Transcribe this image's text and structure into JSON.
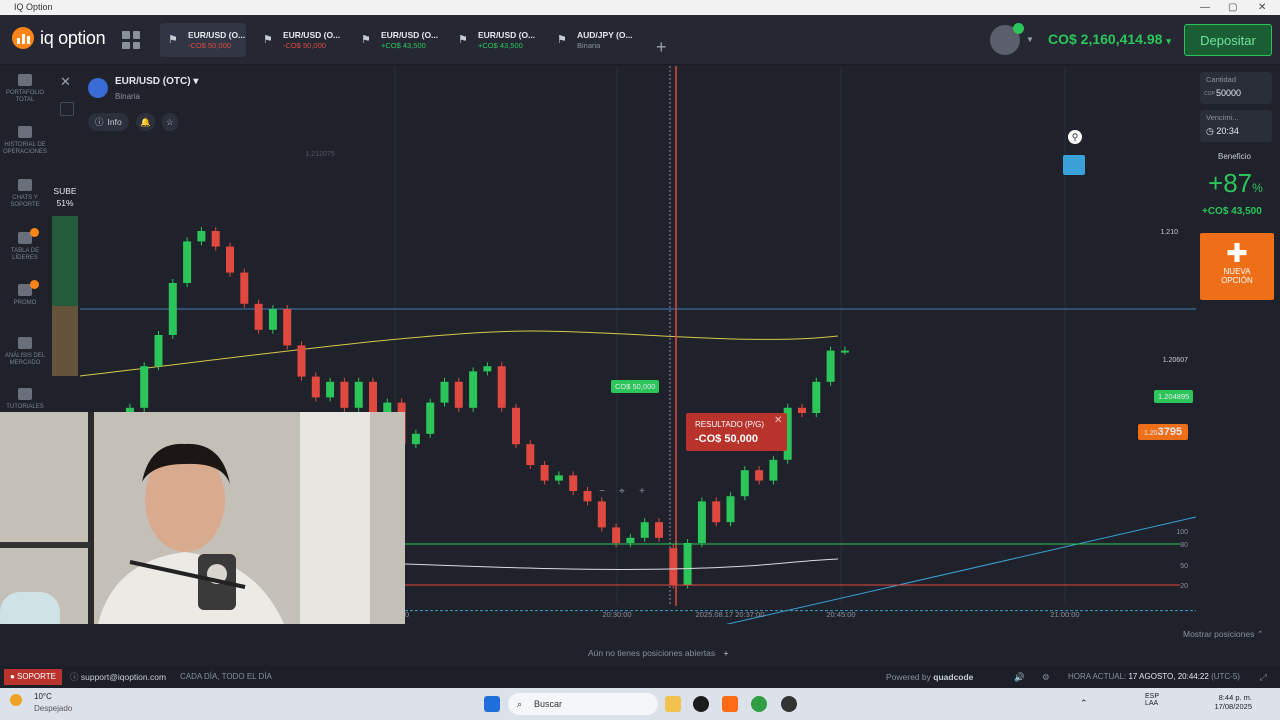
{
  "window": {
    "title": "IQ Option"
  },
  "logo": {
    "text": "iq option"
  },
  "tabs": [
    {
      "title": "EUR/USD (O...",
      "sub": "-CO$ 50,000",
      "tone": "neg",
      "active": true
    },
    {
      "title": "EUR/USD (O...",
      "sub": "-CO$ 50,000",
      "tone": "neg"
    },
    {
      "title": "EUR/USD (O...",
      "sub": "+CO$ 43,500",
      "tone": "pos"
    },
    {
      "title": "EUR/USD (O...",
      "sub": "+CO$ 43,500",
      "tone": "pos"
    },
    {
      "title": "AUD/JPY (O...",
      "sub": "Binaria",
      "tone": "mut"
    }
  ],
  "header": {
    "balance": "CO$ 2,160,414.98",
    "deposit_label": "Depositar"
  },
  "sidebar": {
    "items": [
      {
        "label": "PORTAFOLIO TOTAL"
      },
      {
        "label": "HISTORIAL DE OPERACIONES"
      },
      {
        "label": "CHATS Y SOPORTE"
      },
      {
        "label": "TABLA DE LÍDERES",
        "badge": "2"
      },
      {
        "label": "PROMO",
        "badge": "4"
      },
      {
        "label": "ANÁLISIS DEL MERCADO"
      },
      {
        "label": "TUTORIALES"
      }
    ]
  },
  "asset": {
    "name": "EUR/USD (OTC)",
    "type": "Binaria",
    "info_label": "Info"
  },
  "sentiment": {
    "label": "SUBE",
    "value": "51%"
  },
  "chart": {
    "price_labels": {
      "top": "1.212075",
      "level": "1.210",
      "strike": "1.20607",
      "current": "1.204895",
      "deal": "1.20",
      "deal_big": "3795"
    },
    "x_ticks": [
      "0",
      "20:30:00",
      "2025.08.17 20:37:00",
      "20:45:00",
      "21:00:00"
    ],
    "osc_ticks": [
      "100",
      "80",
      "50",
      "20"
    ],
    "trade_tag": "CO$ 50,000",
    "result": {
      "label": "RESULTADO (P/G)",
      "value": "-CO$ 50,000"
    },
    "candles": [
      {
        "o": 1.2075,
        "c": 1.208
      },
      {
        "o": 1.2077,
        "c": 1.2078
      },
      {
        "o": 1.2078,
        "c": 1.2081
      },
      {
        "o": 1.2078,
        "c": 1.2086
      },
      {
        "o": 1.2086,
        "c": 1.2094
      },
      {
        "o": 1.2094,
        "c": 1.21
      },
      {
        "o": 1.21,
        "c": 1.211
      },
      {
        "o": 1.211,
        "c": 1.2118
      },
      {
        "o": 1.2118,
        "c": 1.212
      },
      {
        "o": 1.212,
        "c": 1.2117
      },
      {
        "o": 1.2117,
        "c": 1.2112
      },
      {
        "o": 1.2112,
        "c": 1.2106
      },
      {
        "o": 1.2106,
        "c": 1.2101
      },
      {
        "o": 1.2101,
        "c": 1.2105
      },
      {
        "o": 1.2105,
        "c": 1.2098
      },
      {
        "o": 1.2098,
        "c": 1.2092
      },
      {
        "o": 1.2092,
        "c": 1.2088
      },
      {
        "o": 1.2088,
        "c": 1.2091
      },
      {
        "o": 1.2091,
        "c": 1.2086
      },
      {
        "o": 1.2086,
        "c": 1.2091
      },
      {
        "o": 1.2091,
        "c": 1.2085
      },
      {
        "o": 1.2085,
        "c": 1.2087
      },
      {
        "o": 1.2087,
        "c": 1.2079
      },
      {
        "o": 1.2079,
        "c": 1.2081
      },
      {
        "o": 1.2081,
        "c": 1.2087
      },
      {
        "o": 1.2087,
        "c": 1.2091
      },
      {
        "o": 1.2091,
        "c": 1.2086
      },
      {
        "o": 1.2086,
        "c": 1.2093
      },
      {
        "o": 1.2093,
        "c": 1.2094
      },
      {
        "o": 1.2094,
        "c": 1.2086
      },
      {
        "o": 1.2086,
        "c": 1.2079
      },
      {
        "o": 1.2079,
        "c": 1.2075
      },
      {
        "o": 1.2075,
        "c": 1.2072
      },
      {
        "o": 1.2072,
        "c": 1.2073
      },
      {
        "o": 1.2073,
        "c": 1.207
      },
      {
        "o": 1.207,
        "c": 1.2068
      },
      {
        "o": 1.2068,
        "c": 1.2063
      },
      {
        "o": 1.2063,
        "c": 1.206
      },
      {
        "o": 1.206,
        "c": 1.2061
      },
      {
        "o": 1.2061,
        "c": 1.2064
      },
      {
        "o": 1.2064,
        "c": 1.2061
      },
      {
        "o": 1.2059,
        "c": 1.2052
      },
      {
        "o": 1.2052,
        "c": 1.206
      },
      {
        "o": 1.206,
        "c": 1.2068
      },
      {
        "o": 1.2068,
        "c": 1.2064
      },
      {
        "o": 1.2064,
        "c": 1.2069
      },
      {
        "o": 1.2069,
        "c": 1.2074
      },
      {
        "o": 1.2074,
        "c": 1.2072
      },
      {
        "o": 1.2072,
        "c": 1.2076
      },
      {
        "o": 1.2076,
        "c": 1.2086
      },
      {
        "o": 1.2086,
        "c": 1.2085
      },
      {
        "o": 1.2085,
        "c": 1.2091
      },
      {
        "o": 1.2091,
        "c": 1.2097
      },
      {
        "o": 1.2097,
        "c": 1.2097
      }
    ]
  },
  "chart_tools": {
    "minus": "−",
    "center": "⌖",
    "plus": "+"
  },
  "right_panel": {
    "amount_label": "Cantidad",
    "amount_currency": "COP",
    "amount_value": "50000",
    "expiry_label": "Vencimi...",
    "expiry_value": "20:34",
    "profit_label": "Beneficio",
    "profit_pct_sign": "+",
    "profit_pct": "87",
    "profit_pct_unit": "%",
    "profit_value": "+CO$ 43,500",
    "new_option_label": "NUEVA OPCIÓN"
  },
  "positions_bar": {
    "empty": "Aún no tienes posiciones abiertas",
    "show": "Mostrar posiciones"
  },
  "status_bar": {
    "support": "SOPORTE",
    "email": "support@iqoption.com",
    "hours": "CADA DÍA, TODO EL DÍA",
    "powered": "Powered by",
    "brand": "quadcode",
    "time_label": "HORA ACTUAL:",
    "time_value": "17 AGOSTO, 20:44:22",
    "tz": "(UTC-5)"
  },
  "taskbar": {
    "temp": "10°C",
    "weather": "Despejado",
    "search": "Buscar",
    "lang": "ESP",
    "lang2": "LAA",
    "clock": "8:44 p. m.",
    "date": "17/08/2025"
  },
  "colors": {
    "accent": "#ff8516",
    "up": "#2cc55a",
    "down": "#e0493f",
    "bg": "#1f222b"
  }
}
